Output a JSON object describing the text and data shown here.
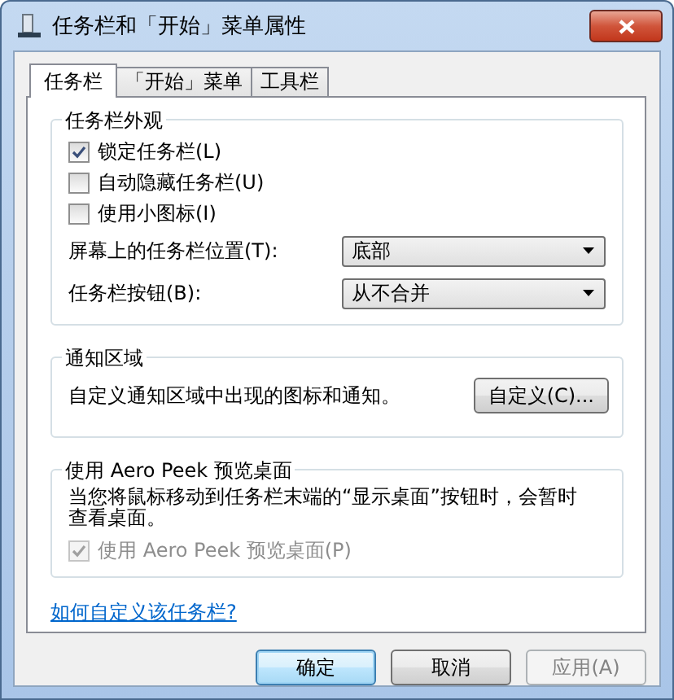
{
  "window": {
    "title": "任务栏和「开始」菜单属性"
  },
  "tabs": [
    {
      "label": "任务栏",
      "selected": true
    },
    {
      "label": "「开始」菜单",
      "selected": false
    },
    {
      "label": "工具栏",
      "selected": false
    }
  ],
  "groups": [
    {
      "title": "任务栏外观",
      "items": [
        {
          "kind": "checkbox",
          "label": "锁定任务栏(L)",
          "checked": true,
          "disabled": false
        },
        {
          "kind": "checkbox",
          "label": "自动隐藏任务栏(U)",
          "checked": false,
          "disabled": false
        },
        {
          "kind": "checkbox",
          "label": "使用小图标(I)",
          "checked": false,
          "disabled": false
        },
        {
          "kind": "dropdown",
          "label": "屏幕上的任务栏位置(T):",
          "value": "底部"
        },
        {
          "kind": "dropdown",
          "label": "任务栏按钮(B):",
          "value": "从不合并"
        }
      ]
    },
    {
      "title": "通知区域",
      "items": [
        {
          "kind": "text-button",
          "text": "自定义通知区域中出现的图标和通知。",
          "button": "自定义(C)..."
        }
      ]
    },
    {
      "title": "使用 Aero Peek 预览桌面",
      "items": [
        {
          "kind": "text",
          "text": "当您将鼠标移动到任务栏末端的“显示桌面”按钮时，会暂时查看桌面。"
        },
        {
          "kind": "checkbox",
          "label": "使用 Aero Peek 预览桌面(P)",
          "checked": true,
          "disabled": true
        }
      ]
    }
  ],
  "link": "如何自定义该任务栏?",
  "buttons": [
    {
      "label": "确定",
      "default": true,
      "disabled": false
    },
    {
      "label": "取消",
      "default": false,
      "disabled": false
    },
    {
      "label": "应用(A)",
      "default": false,
      "disabled": true
    }
  ]
}
